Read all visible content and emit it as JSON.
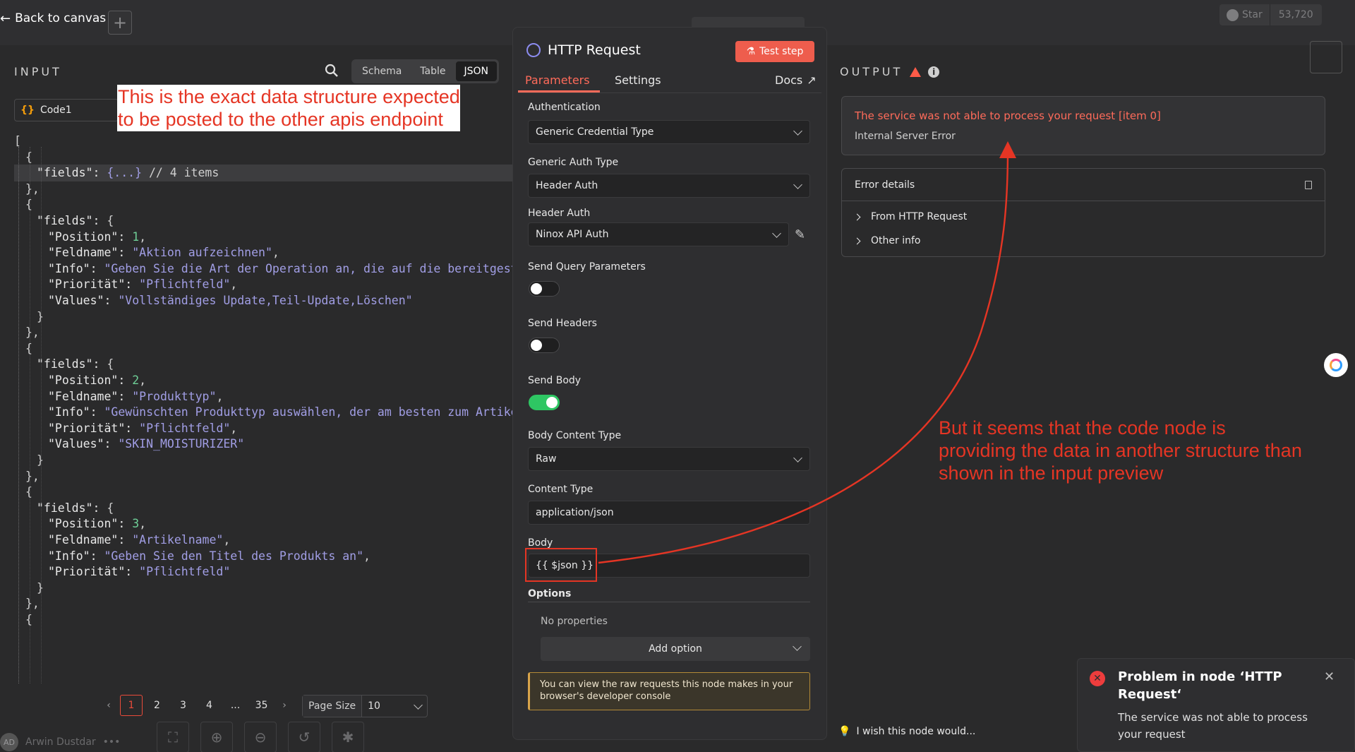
{
  "topbar": {
    "back_label": "Back to canvas",
    "add_label": "+",
    "star_label": "Star",
    "star_count": "53,720"
  },
  "input": {
    "title": "INPUT",
    "views": [
      "Schema",
      "Table",
      "JSON"
    ],
    "active_view": "JSON",
    "node_chip": "Code1",
    "annotation": "This is the exact data structure expected to be posted to the other apis endpoint",
    "json_lines": [
      {
        "indent": 0,
        "parts": [
          [
            "c",
            "["
          ]
        ]
      },
      {
        "indent": 1,
        "parts": [
          [
            "c",
            "{"
          ]
        ]
      },
      {
        "indent": 2,
        "hl": true,
        "parts": [
          [
            "k",
            "\"fields\": "
          ],
          [
            "s",
            "{...}"
          ],
          [
            "c",
            " // 4 items"
          ]
        ]
      },
      {
        "indent": 1,
        "parts": [
          [
            "c",
            "},"
          ]
        ]
      },
      {
        "indent": 1,
        "parts": [
          [
            "c",
            "{"
          ]
        ]
      },
      {
        "indent": 2,
        "parts": [
          [
            "k",
            "\"fields\": "
          ],
          [
            "c",
            "{"
          ]
        ]
      },
      {
        "indent": 3,
        "parts": [
          [
            "k",
            "\"Position\": "
          ],
          [
            "n",
            "1"
          ],
          [
            "c",
            ","
          ]
        ]
      },
      {
        "indent": 3,
        "parts": [
          [
            "k",
            "\"Feldname\": "
          ],
          [
            "s",
            "\"Aktion aufzeichnen\""
          ],
          [
            "c",
            ","
          ]
        ]
      },
      {
        "indent": 3,
        "parts": [
          [
            "k",
            "\"Info\": "
          ],
          [
            "s",
            "\"Geben Sie die Art der Operation an, die auf die bereitgeste"
          ]
        ]
      },
      {
        "indent": 3,
        "parts": [
          [
            "k",
            "\"Priorität\": "
          ],
          [
            "s",
            "\"Pflichtfeld\""
          ],
          [
            "c",
            ","
          ]
        ]
      },
      {
        "indent": 3,
        "parts": [
          [
            "k",
            "\"Values\": "
          ],
          [
            "s",
            "\"Vollständiges Update,Teil-Update,Löschen\""
          ]
        ]
      },
      {
        "indent": 2,
        "parts": [
          [
            "c",
            "}"
          ]
        ]
      },
      {
        "indent": 1,
        "parts": [
          [
            "c",
            "},"
          ]
        ]
      },
      {
        "indent": 1,
        "parts": [
          [
            "c",
            "{"
          ]
        ]
      },
      {
        "indent": 2,
        "parts": [
          [
            "k",
            "\"fields\": "
          ],
          [
            "c",
            "{"
          ]
        ]
      },
      {
        "indent": 3,
        "parts": [
          [
            "k",
            "\"Position\": "
          ],
          [
            "n",
            "2"
          ],
          [
            "c",
            ","
          ]
        ]
      },
      {
        "indent": 3,
        "parts": [
          [
            "k",
            "\"Feldname\": "
          ],
          [
            "s",
            "\"Produkttyp\""
          ],
          [
            "c",
            ","
          ]
        ]
      },
      {
        "indent": 3,
        "parts": [
          [
            "k",
            "\"Info\": "
          ],
          [
            "s",
            "\"Gewünschten Produkttyp auswählen, der am besten zum Artikel"
          ]
        ]
      },
      {
        "indent": 3,
        "parts": [
          [
            "k",
            "\"Priorität\": "
          ],
          [
            "s",
            "\"Pflichtfeld\""
          ],
          [
            "c",
            ","
          ]
        ]
      },
      {
        "indent": 3,
        "parts": [
          [
            "k",
            "\"Values\": "
          ],
          [
            "s",
            "\"SKIN_MOISTURIZER\""
          ]
        ]
      },
      {
        "indent": 2,
        "parts": [
          [
            "c",
            "}"
          ]
        ]
      },
      {
        "indent": 1,
        "parts": [
          [
            "c",
            "},"
          ]
        ]
      },
      {
        "indent": 1,
        "parts": [
          [
            "c",
            "{"
          ]
        ]
      },
      {
        "indent": 2,
        "parts": [
          [
            "k",
            "\"fields\": "
          ],
          [
            "c",
            "{"
          ]
        ]
      },
      {
        "indent": 3,
        "parts": [
          [
            "k",
            "\"Position\": "
          ],
          [
            "n",
            "3"
          ],
          [
            "c",
            ","
          ]
        ]
      },
      {
        "indent": 3,
        "parts": [
          [
            "k",
            "\"Feldname\": "
          ],
          [
            "s",
            "\"Artikelname\""
          ],
          [
            "c",
            ","
          ]
        ]
      },
      {
        "indent": 3,
        "parts": [
          [
            "k",
            "\"Info\": "
          ],
          [
            "s",
            "\"Geben Sie den Titel des Produkts an\""
          ],
          [
            "c",
            ","
          ]
        ]
      },
      {
        "indent": 3,
        "parts": [
          [
            "k",
            "\"Priorität\": "
          ],
          [
            "s",
            "\"Pflichtfeld\""
          ]
        ]
      },
      {
        "indent": 2,
        "parts": [
          [
            "c",
            "}"
          ]
        ]
      },
      {
        "indent": 1,
        "parts": [
          [
            "c",
            "},"
          ]
        ]
      },
      {
        "indent": 1,
        "parts": [
          [
            "c",
            "{"
          ]
        ]
      }
    ],
    "pagination": {
      "pages": [
        "1",
        "2",
        "3",
        "4",
        "...",
        "35"
      ],
      "active": "1",
      "page_size_label": "Page Size",
      "page_size_value": "10"
    }
  },
  "modal": {
    "title": "HTTP Request",
    "test_button": "Test step",
    "tabs": [
      "Parameters",
      "Settings"
    ],
    "active_tab": "Parameters",
    "docs_label": "Docs",
    "authentication_label": "Authentication",
    "authentication_value": "Generic Credential Type",
    "generic_auth_label": "Generic Auth Type",
    "generic_auth_value": "Header Auth",
    "header_auth_label": "Header Auth",
    "header_auth_value": "Ninox API Auth",
    "send_query_label": "Send Query Parameters",
    "send_query_on": false,
    "send_headers_label": "Send Headers",
    "send_headers_on": false,
    "send_body_label": "Send Body",
    "send_body_on": true,
    "body_content_type_label": "Body Content Type",
    "body_content_type_value": "Raw",
    "content_type_label": "Content Type",
    "content_type_value": "application/json",
    "body_label": "Body",
    "body_value": "{{ $json }}",
    "options_label": "Options",
    "no_properties": "No properties",
    "add_option": "Add option",
    "notice": "You can view the raw requests this node makes in your browser's developer console"
  },
  "output": {
    "title": "OUTPUT",
    "error_title": "The service was not able to process your request [item 0]",
    "error_subtitle": "Internal Server Error",
    "details_title": "Error details",
    "details_items": [
      "From HTTP Request",
      "Other info"
    ],
    "annotation": "But it seems that the code node is providing the data in another structure than shown in the input preview"
  },
  "bottombar": {
    "user_initials": "AD",
    "user_name": "Arwin Dustdar",
    "user_menu": "•••",
    "wish_text": "I wish this node would..."
  },
  "toast": {
    "title": "Problem in node ‘HTTP Request‘",
    "message": "The service was not able to process your request"
  },
  "colors": {
    "accent": "#ff6b5a",
    "error": "#ee3d3d",
    "annotation": "#e53524",
    "toggle_on": "#2ec663"
  }
}
